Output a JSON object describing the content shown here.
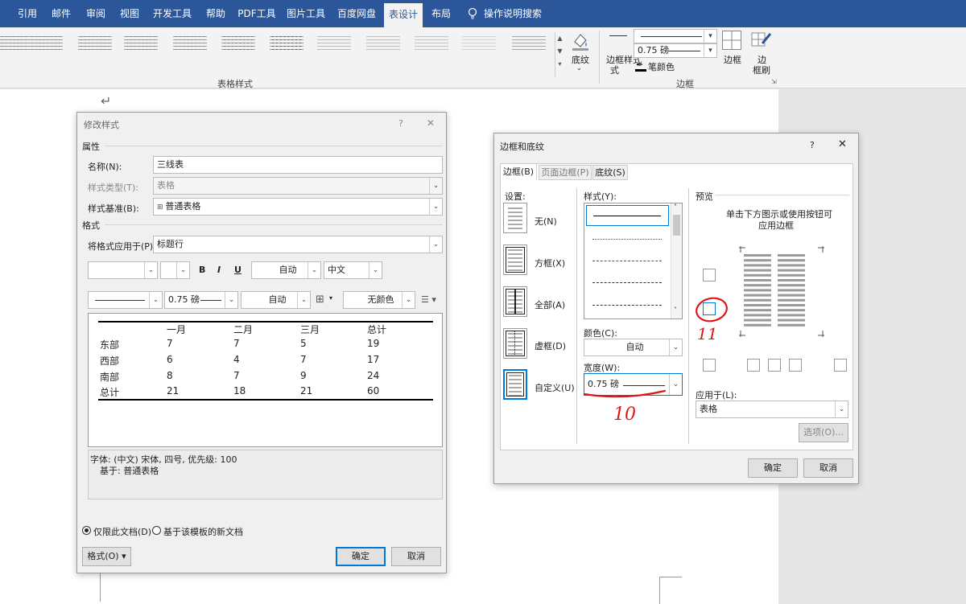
{
  "ribbon": {
    "tabs": [
      "引用",
      "邮件",
      "审阅",
      "视图",
      "开发工具",
      "帮助",
      "PDF工具",
      "图片工具",
      "百度网盘",
      "表设计",
      "布局",
      "操作说明搜索"
    ],
    "group_label_styles": "表格样式",
    "group_label_borders": "边框",
    "shading": "底纹",
    "border_styles": "边框样式",
    "border_styles_2": "式",
    "width_value": "0.75 磅",
    "pen_color": "笔颜色",
    "borders_btn": "边框",
    "border_painter_1": "边",
    "border_painter_2": "框刷"
  },
  "modify": {
    "title": "修改样式",
    "help": "?",
    "close": "✕",
    "section_props": "属性",
    "name_label": "名称(N):",
    "name_value": "三线表",
    "type_label": "样式类型(T):",
    "type_value": "表格",
    "based_label": "样式基准(B):",
    "based_value": "普通表格",
    "section_format": "格式",
    "apply_label": "将格式应用于(P):",
    "apply_value": "标题行",
    "bold": "B",
    "italic": "I",
    "underline": "U",
    "auto1": "自动",
    "lang": "中文",
    "width": "0.75 磅",
    "auto2": "自动",
    "nocolor": "无颜色",
    "table": {
      "headers": [
        "",
        "一月",
        "二月",
        "三月",
        "总计"
      ],
      "rows": [
        [
          "东部",
          "7",
          "7",
          "5",
          "19"
        ],
        [
          "西部",
          "6",
          "4",
          "7",
          "17"
        ],
        [
          "南部",
          "8",
          "7",
          "9",
          "24"
        ],
        [
          "总计",
          "21",
          "18",
          "21",
          "60"
        ]
      ]
    },
    "desc1": "字体: (中文) 宋体, 四号, 优先级: 100",
    "desc2": "基于: 普通表格",
    "radio1": "仅限此文档(D)",
    "radio2": "基于该模板的新文档",
    "format_btn": "格式(O)",
    "ok": "确定",
    "cancel": "取消"
  },
  "borders": {
    "title": "边框和底纹",
    "help": "?",
    "close": "✕",
    "tab1": "边框(B)",
    "tab2": "页面边框(P)",
    "tab3": "底纹(S)",
    "settings": "设置:",
    "s_none": "无(N)",
    "s_box": "方框(X)",
    "s_all": "全部(A)",
    "s_grid": "虚框(D)",
    "s_custom": "自定义(U)",
    "style": "样式(Y):",
    "color": "颜色(C):",
    "color_value": "自动",
    "width": "宽度(W):",
    "width_value": "0.75 磅",
    "preview": "预览",
    "hint1": "单击下方图示或使用按钮可",
    "hint2": "应用边框",
    "apply": "应用于(L):",
    "apply_value": "表格",
    "options": "选项(O)...",
    "ok": "确定",
    "cancel": "取消"
  },
  "annotations": {
    "ten": "10",
    "eleven": "11"
  }
}
